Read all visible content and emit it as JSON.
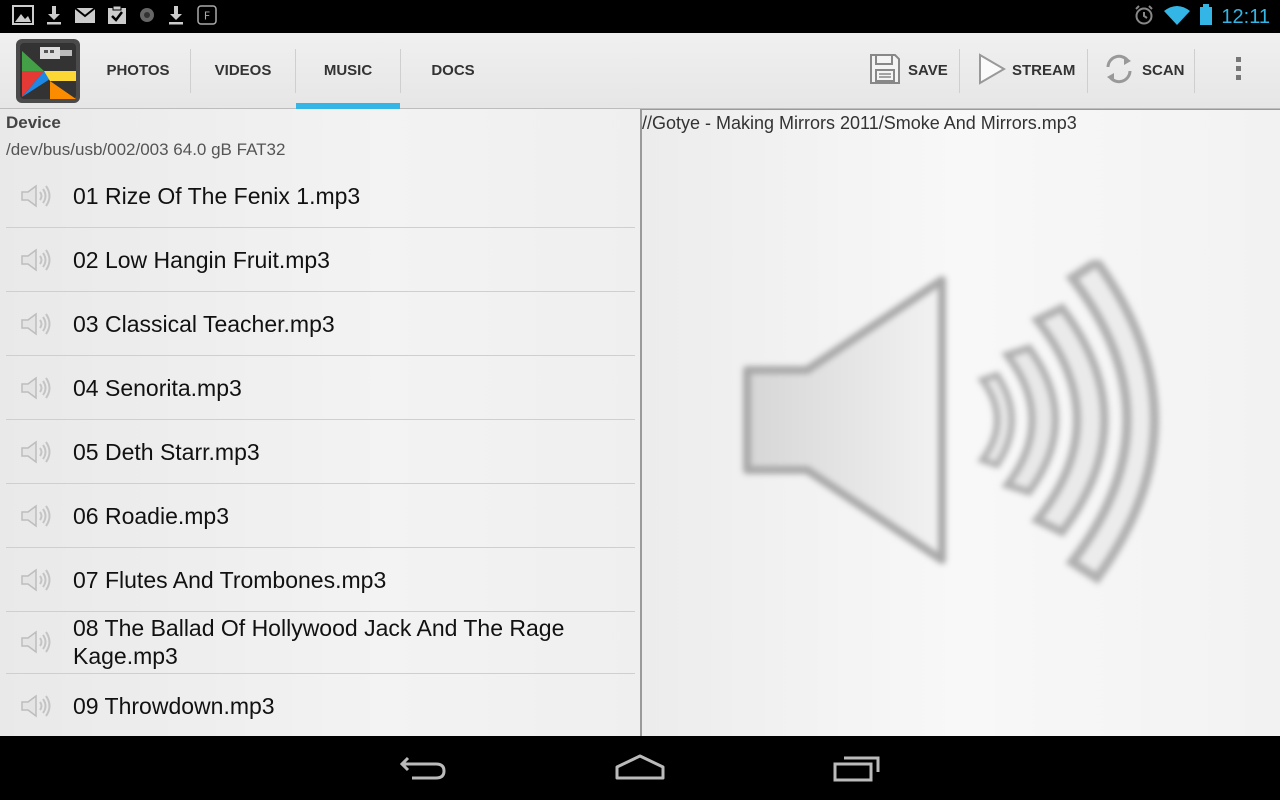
{
  "status_bar": {
    "notification_icons": [
      "image-icon",
      "download-icon",
      "gmail-icon",
      "checklist-icon",
      "record-icon",
      "download-icon",
      "flipboard-icon"
    ],
    "clock": "12:11"
  },
  "action_bar": {
    "tabs": [
      {
        "label": "PHOTOS",
        "active": false
      },
      {
        "label": "VIDEOS",
        "active": false
      },
      {
        "label": "MUSIC",
        "active": true
      },
      {
        "label": "DOCS",
        "active": false
      }
    ],
    "actions": [
      {
        "label": "SAVE",
        "icon": "floppy-icon"
      },
      {
        "label": "STREAM",
        "icon": "play-icon"
      },
      {
        "label": "SCAN",
        "icon": "refresh-icon"
      }
    ],
    "accent_color": "#33b5e5"
  },
  "device": {
    "title": "Device",
    "info": "/dev/bus/usb/002/003 64.0 gB FAT32"
  },
  "files": [
    {
      "name": "01 Rize Of The Fenix 1.mp3"
    },
    {
      "name": "02 Low Hangin Fruit.mp3"
    },
    {
      "name": "03 Classical Teacher.mp3"
    },
    {
      "name": "04 Senorita.mp3"
    },
    {
      "name": "05 Deth Starr.mp3"
    },
    {
      "name": "06 Roadie.mp3"
    },
    {
      "name": "07 Flutes And Trombones.mp3"
    },
    {
      "name": "08 The Ballad Of Hollywood Jack And The Rage Kage.mp3"
    },
    {
      "name": "09 Throwdown.mp3"
    }
  ],
  "preview": {
    "path": "//Gotye - Making Mirrors 2011/Smoke And Mirrors.mp3",
    "icon": "speaker-icon"
  },
  "nav_bar": {
    "buttons": [
      "back-icon",
      "home-icon",
      "recents-icon"
    ]
  }
}
